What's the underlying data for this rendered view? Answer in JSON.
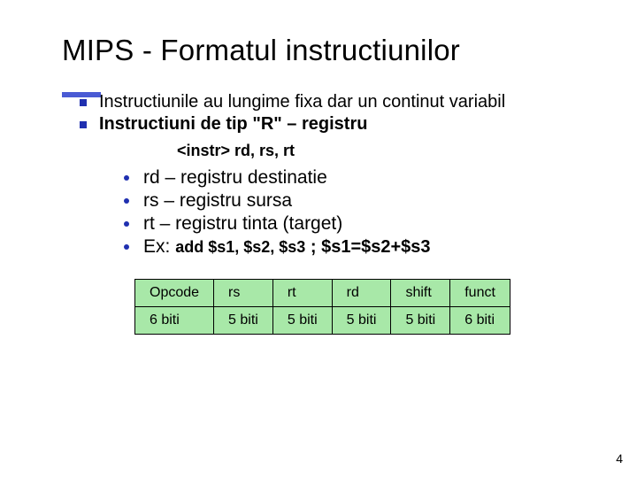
{
  "title": "MIPS - Formatul instructiunilor",
  "bullets": {
    "top": [
      "Instructiunile au lungime fixa dar un continut variabil",
      "Instructiuni de tip \"R\" – registru"
    ],
    "syntax_line": "<instr>  rd, rs, rt",
    "sub": [
      "rd – registru destinatie",
      "rs – registru sursa",
      "rt – registru tinta (target)"
    ],
    "example": {
      "prefix": "Ex: ",
      "code": "add $s1, $s2, $s3",
      "result": "  ; $s1=$s2+$s3"
    }
  },
  "table": {
    "headers": [
      "Opcode",
      "rs",
      "rt",
      "rd",
      "shift",
      "funct"
    ],
    "widths": [
      "6 biti",
      "5 biti",
      "5 biti",
      "5 biti",
      "5 biti",
      "6 biti"
    ]
  },
  "page_number": "4"
}
